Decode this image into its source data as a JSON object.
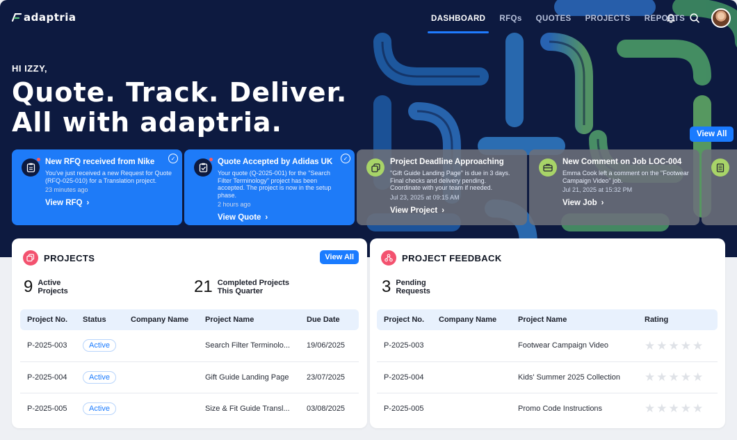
{
  "brand": {
    "name": "adaptria"
  },
  "nav": {
    "items": [
      {
        "label": "DASHBOARD",
        "active": true
      },
      {
        "label": "RFQs",
        "active": false
      },
      {
        "label": "QUOTES",
        "active": false
      },
      {
        "label": "PROJECTS",
        "active": false
      },
      {
        "label": "REPORTS",
        "active": false
      }
    ],
    "icons": [
      "bell-icon",
      "search-icon",
      "user-avatar"
    ]
  },
  "hero": {
    "greeting": "HI IZZY,",
    "headline_line1": "Quote. Track. Deliver.",
    "headline_line2": "All with adaptria.",
    "view_all": "View All"
  },
  "notifications": [
    {
      "title": "New RFQ received from Nike",
      "body": "You've just received a new Request for Quote (RFQ-025-010) for a Translation project.",
      "time": "23 minutes ago",
      "link": "View RFQ",
      "icon": "clipboard-icon",
      "style": "blue"
    },
    {
      "title": "Quote Accepted by Adidas UK",
      "body": "Your quote (Q-2025-001) for the \"Search Filter Terminology\" project has been accepted. The project is now in the setup phase.",
      "time": "2 hours ago",
      "link": "View Quote",
      "icon": "clipboard-check-icon",
      "style": "blue"
    },
    {
      "title": "Project Deadline Approaching",
      "body": "\"Gift Guide Landing Page\" is due in 3 days. Final checks and delivery pending. Coordinate with your team if needed.",
      "time": "Jul 23, 2025 at 09:15 AM",
      "link": "View Project",
      "icon": "copy-icon",
      "style": "grey"
    },
    {
      "title": "New Comment on Job LOC-004",
      "body": "Emma Cook left a comment on the \"Footwear Campaign Video\" job.",
      "time": "Jul 21, 2025 at 15:32 PM",
      "link": "View Job",
      "icon": "briefcase-icon",
      "style": "grey"
    }
  ],
  "projects": {
    "title": "PROJECTS",
    "view_all": "View All",
    "stat1_num": "9",
    "stat1_line1": "Active",
    "stat1_line2": "Projects",
    "stat2_num": "21",
    "stat2_line1": "Completed Projects",
    "stat2_line2": "This Quarter",
    "columns": [
      "Project No.",
      "Status",
      "Company Name",
      "Project Name",
      "Due Date"
    ],
    "rows": [
      {
        "no": "P-2025-003",
        "status": "Active",
        "company": "",
        "name": "Search Filter Terminolo...",
        "due": "19/06/2025"
      },
      {
        "no": "P-2025-004",
        "status": "Active",
        "company": "",
        "name": "Gift Guide Landing Page",
        "due": "23/07/2025"
      },
      {
        "no": "P-2025-005",
        "status": "Active",
        "company": "",
        "name": "Size & Fit Guide Transl...",
        "due": "03/08/2025"
      }
    ]
  },
  "feedback": {
    "title": "PROJECT FEEDBACK",
    "stat_num": "3",
    "stat_line1": "Pending",
    "stat_line2": "Requests",
    "columns": [
      "Project No.",
      "Company Name",
      "Project Name",
      "Rating"
    ],
    "rows": [
      {
        "no": "P-2025-003",
        "company": "",
        "name": "Footwear Campaign Video",
        "rating": 0
      },
      {
        "no": "P-2025-004",
        "company": "",
        "name": "Kids' Summer 2025 Collection",
        "rating": 0
      },
      {
        "no": "P-2025-005",
        "company": "",
        "name": "Promo Code Instructions",
        "rating": 0
      }
    ]
  },
  "colors": {
    "hero_bg": "#0d1a40",
    "accent_blue": "#1a7bff",
    "notification_icon_green": "#a8d468",
    "panel_icon_pink": "#f3526f"
  }
}
